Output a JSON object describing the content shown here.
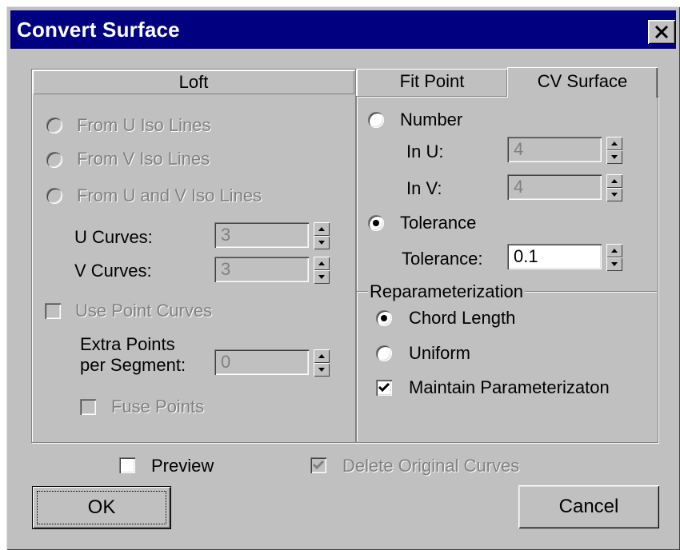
{
  "window": {
    "title": "Convert Surface",
    "close_icon": "close-icon"
  },
  "loft": {
    "header": "Loft",
    "from_u": "From U Iso Lines",
    "from_v": "From V Iso Lines",
    "from_uv": "From U and V Iso Lines",
    "u_curves_label": "U Curves:",
    "u_curves_value": "3",
    "v_curves_label": "V Curves:",
    "v_curves_value": "3",
    "use_point_curves": "Use Point Curves",
    "extra_points_line1": "Extra Points",
    "extra_points_line2": "per Segment:",
    "extra_points_value": "0",
    "fuse_points": "Fuse Points"
  },
  "tabs": {
    "fit_point": "Fit Point",
    "cv_surface": "CV Surface"
  },
  "cv": {
    "number": "Number",
    "in_u_label": "In U:",
    "in_u_value": "4",
    "in_v_label": "In V:",
    "in_v_value": "4",
    "tolerance": "Tolerance",
    "tolerance_label": "Tolerance:",
    "tolerance_value": "0.1"
  },
  "reparam": {
    "legend": "Reparameterization",
    "chord_length": "Chord Length",
    "uniform": "Uniform",
    "maintain": "Maintain Parameterizaton"
  },
  "bottom": {
    "preview": "Preview",
    "delete_original": "Delete Original Curves",
    "ok": "OK",
    "cancel": "Cancel"
  }
}
